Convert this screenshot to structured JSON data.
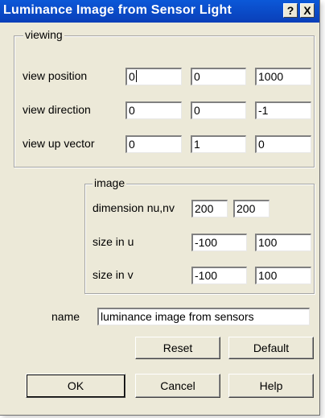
{
  "window": {
    "title": "Luminance Image from Sensor Light",
    "help_glyph": "?",
    "close_glyph": "X"
  },
  "viewing": {
    "legend": "viewing",
    "rows": [
      {
        "label": "view position",
        "values": [
          "0",
          "0",
          "1000"
        ]
      },
      {
        "label": "view direction",
        "values": [
          "0",
          "0",
          "-1"
        ]
      },
      {
        "label": "view up vector",
        "values": [
          "0",
          "1",
          "0"
        ]
      }
    ]
  },
  "image": {
    "legend": "image",
    "dimension": {
      "label": "dimension nu,nv",
      "values": [
        "200",
        "200"
      ]
    },
    "size_u": {
      "label": "size in u",
      "values": [
        "-100",
        "100"
      ]
    },
    "size_v": {
      "label": "size in v",
      "values": [
        "-100",
        "100"
      ]
    }
  },
  "name": {
    "label": "name",
    "value": "luminance image from sensors"
  },
  "buttons": {
    "reset": "Reset",
    "default": "Default",
    "ok": "OK",
    "cancel": "Cancel",
    "help": "Help"
  }
}
